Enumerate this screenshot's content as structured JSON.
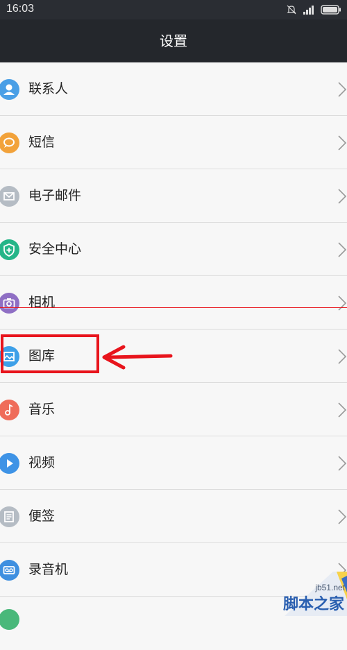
{
  "status_bar": {
    "time": "16:03"
  },
  "header": {
    "title": "设置"
  },
  "settings": [
    {
      "label": "联系人",
      "icon": "person-icon",
      "color": "#4a9fe6"
    },
    {
      "label": "短信",
      "icon": "chat-bubble-icon",
      "color": "#f2a23a"
    },
    {
      "label": "电子邮件",
      "icon": "envelope-icon",
      "color": "#b5bcc4"
    },
    {
      "label": "安全中心",
      "icon": "shield-icon",
      "color": "#24b588"
    },
    {
      "label": "相机",
      "icon": "camera-icon",
      "color": "#8f6fc4"
    },
    {
      "label": "图库",
      "icon": "picture-icon",
      "color": "#3ea0e8"
    },
    {
      "label": "音乐",
      "icon": "music-note-icon",
      "color": "#ef6c5a"
    },
    {
      "label": "视频",
      "icon": "play-icon",
      "color": "#3e93e6"
    },
    {
      "label": "便签",
      "icon": "note-icon",
      "color": "#b5bcc4"
    },
    {
      "label": "录音机",
      "icon": "recorder-icon",
      "color": "#3e8fe0"
    }
  ],
  "annotation": {
    "highlight_color": "#e8141c"
  },
  "watermark": {
    "line1": "jb51.net",
    "line2": "脚本之家"
  }
}
